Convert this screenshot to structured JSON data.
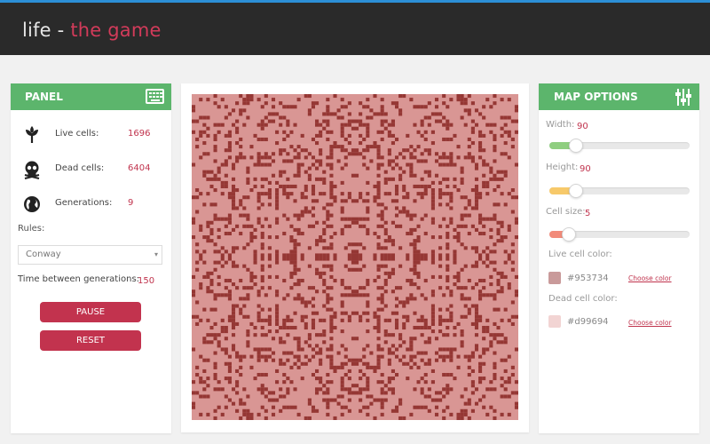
{
  "header": {
    "title_main": "life - ",
    "title_accent": "the game"
  },
  "panel": {
    "title": "PANEL",
    "stats": [
      {
        "icon": "plant-icon",
        "label": "Live cells:",
        "value": "1696"
      },
      {
        "icon": "skull-icon",
        "label": "Dead cells:",
        "value": "6404"
      },
      {
        "icon": "globe-icon",
        "label": "Generations:",
        "value": "9"
      }
    ],
    "rules_label": "Rules:",
    "rules_selected": "Conway",
    "time_label": "Time between generations:",
    "time_value": "150",
    "pause_label": "PAUSE",
    "reset_label": "RESET"
  },
  "map_options": {
    "title": "MAP OPTIONS",
    "width_label": "Width:",
    "width_value": "90",
    "height_label": "Height:",
    "height_value": "90",
    "cell_size_label": "Cell size:",
    "cell_size_value": "5",
    "live_color_label": "Live cell color:",
    "live_color_value": "#953734",
    "dead_color_label": "Dead cell color:",
    "dead_color_value": "#d99694",
    "choose_color_label": "Choose color"
  },
  "colors": {
    "header_bg": "#2a2a2a",
    "accent_blue": "#2c8fd6",
    "panel_header": "#5cb56c",
    "button": "#c2334e",
    "live_cell": "#953734",
    "dead_cell": "#d99694",
    "slider_width": "#8fce80",
    "slider_height": "#f7c96a",
    "slider_cell": "#f28b7a"
  },
  "board": {
    "columns": 90,
    "rows": 90,
    "cell_size": 5
  }
}
